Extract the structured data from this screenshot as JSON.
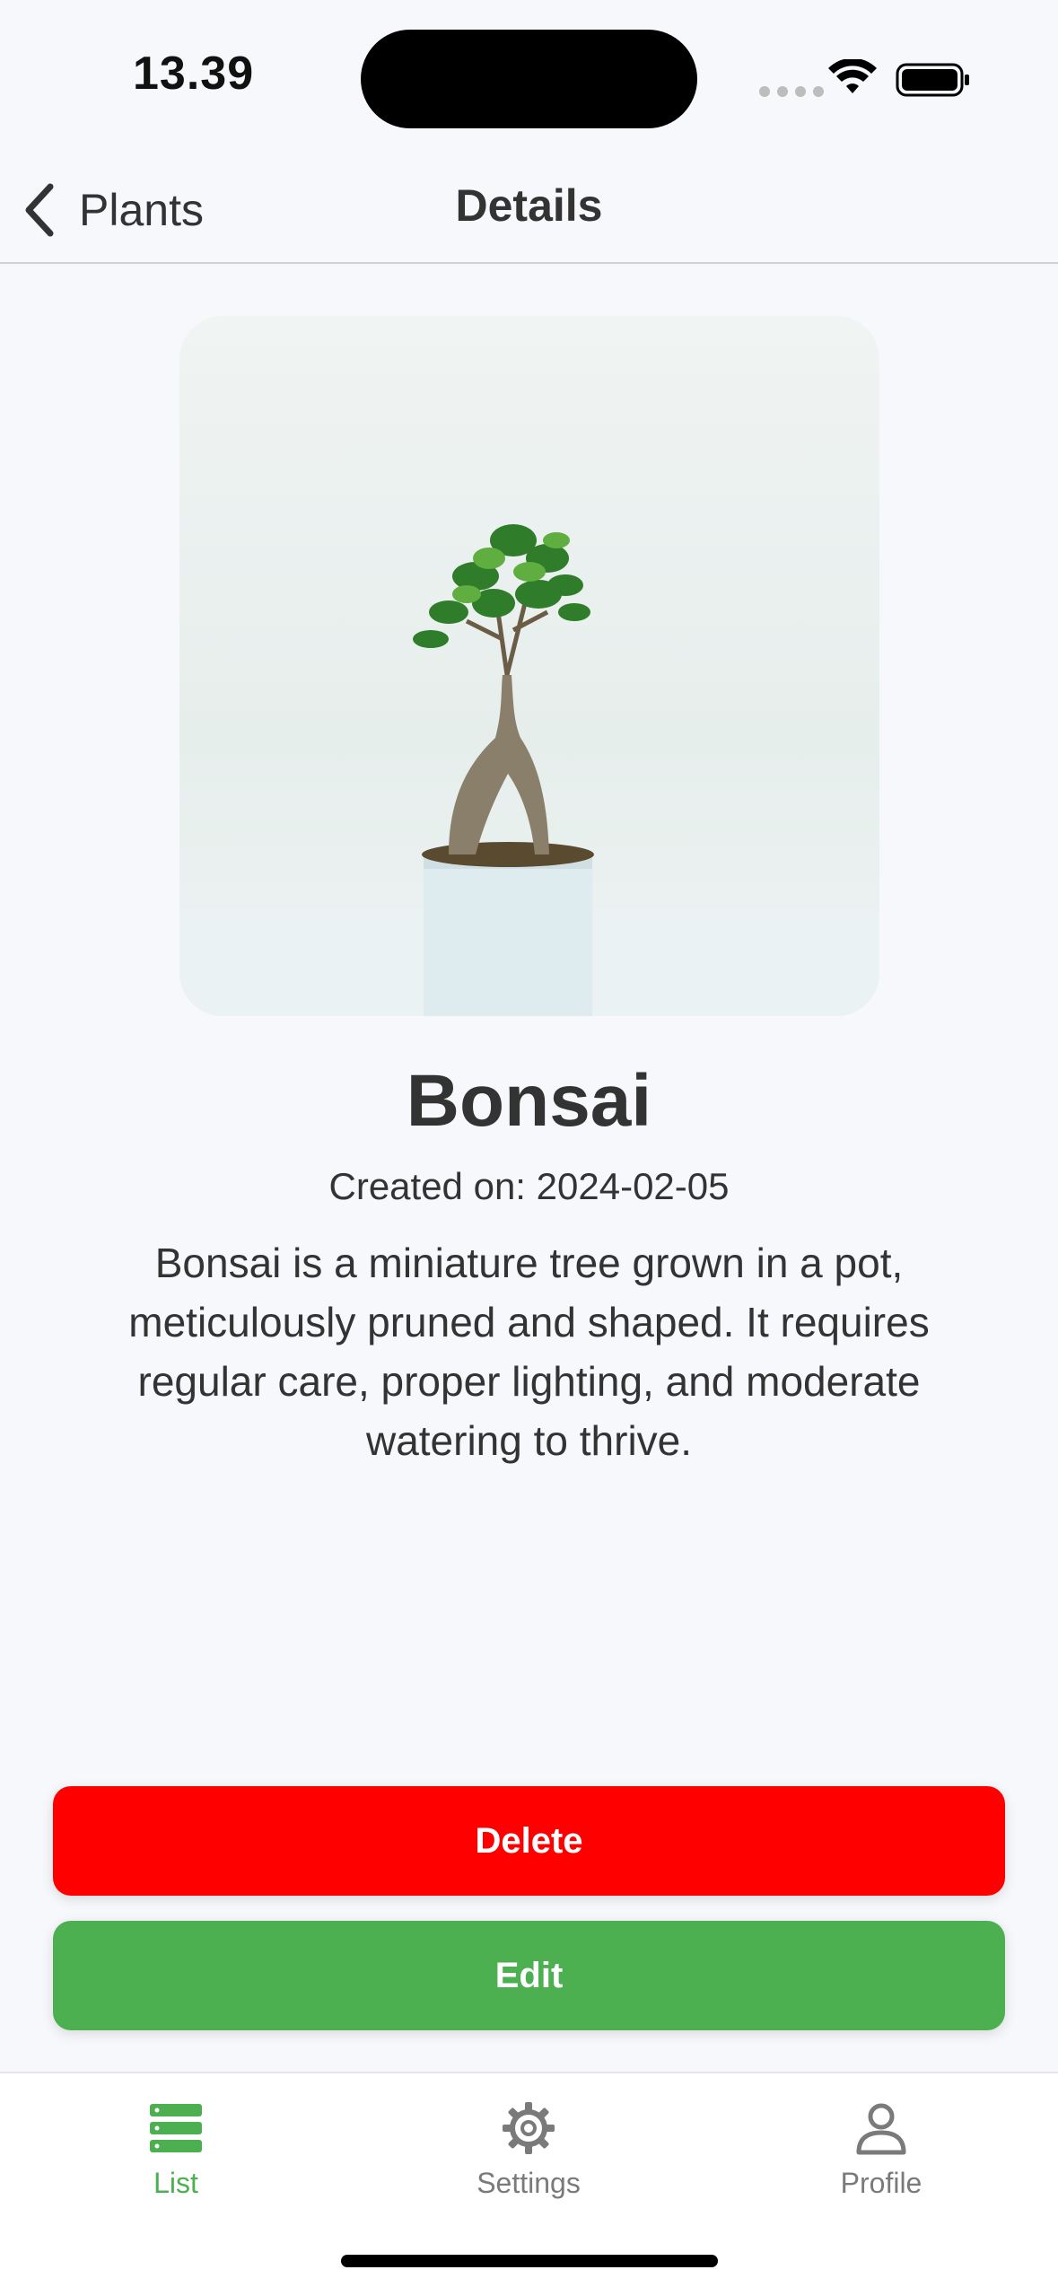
{
  "status_bar": {
    "time": "13.39"
  },
  "nav": {
    "back_label": "Plants",
    "title": "Details"
  },
  "plant": {
    "name": "Bonsai",
    "created_on": "Created on: 2024-02-05",
    "description": "Bonsai is a miniature tree grown in a pot, meticulously pruned and shaped. It requires regular care, proper lighting, and moderate watering to thrive."
  },
  "actions": {
    "delete_label": "Delete",
    "edit_label": "Edit"
  },
  "tabs": [
    {
      "label": "List",
      "icon": "list-icon",
      "active": true
    },
    {
      "label": "Settings",
      "icon": "gear-icon",
      "active": false
    },
    {
      "label": "Profile",
      "icon": "person-icon",
      "active": false
    }
  ],
  "colors": {
    "accent": "#4caf50",
    "danger": "#ff0000",
    "background": "#f7f8fc",
    "text": "#333333",
    "inactive": "#7a7a7a"
  }
}
